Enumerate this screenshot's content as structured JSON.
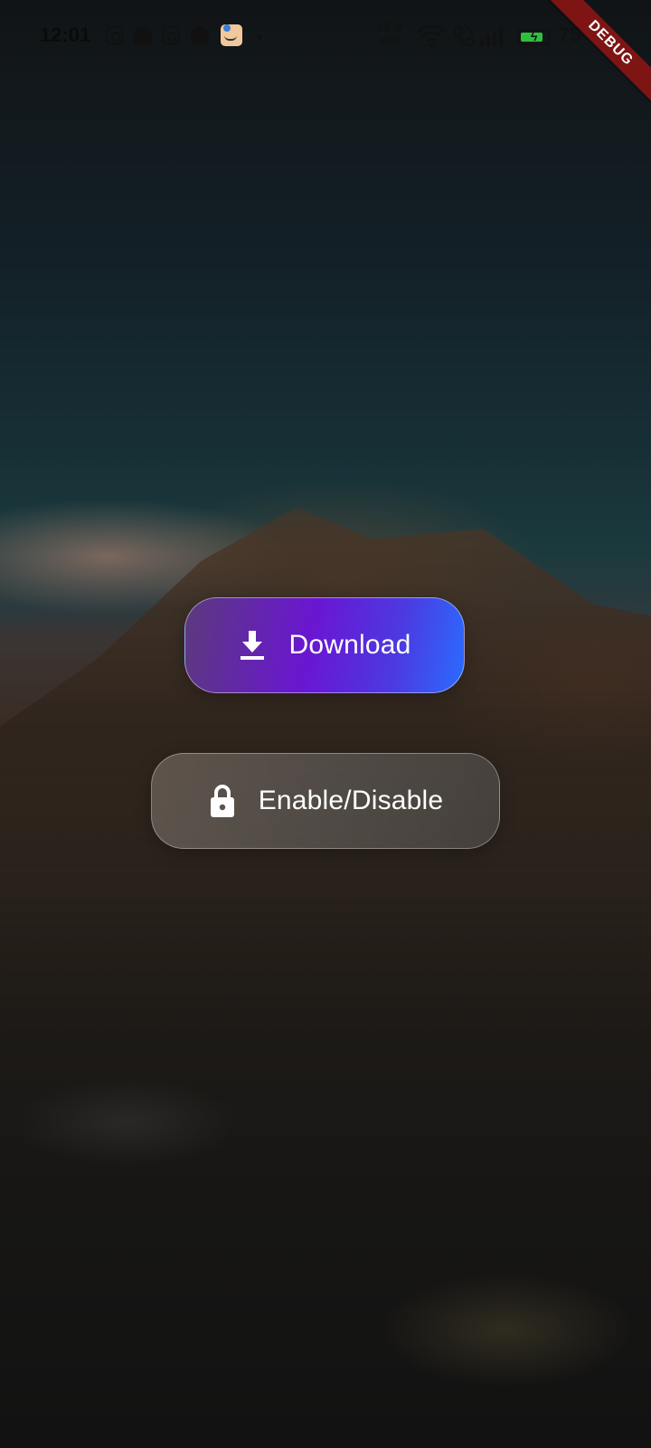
{
  "status_bar": {
    "time": "12:01",
    "network_speed_value": "16.0",
    "network_speed_unit": "KB/S",
    "battery_percent": "75",
    "notification_icons": [
      "instagram-icon",
      "snapchat-icon",
      "instagram-icon",
      "snapchat-icon",
      "amazon-icon"
    ]
  },
  "debug_banner": "DEBUG",
  "buttons": {
    "download_label": "Download",
    "download_icon": "download-icon",
    "toggle_label": "Enable/Disable",
    "toggle_icon": "lock-icon"
  },
  "colors": {
    "download_gradient": [
      "#5b3a7c",
      "#6a16d2",
      "#2b6bff"
    ],
    "debug_banner": "#7e1414",
    "battery_fill": "#2fbf3f"
  }
}
